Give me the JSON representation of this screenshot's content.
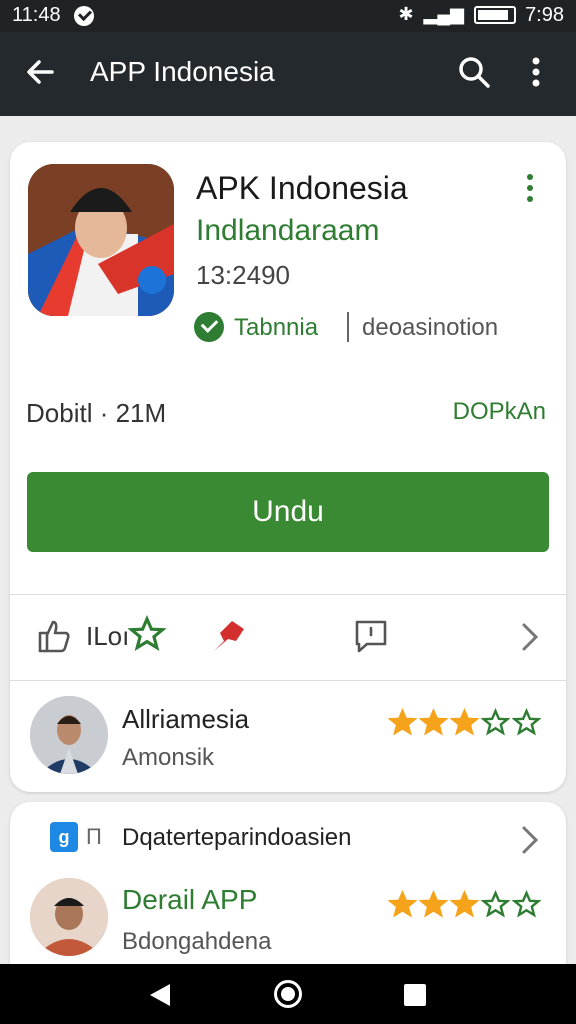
{
  "status_bar": {
    "time": "11:48",
    "clock": "7:98",
    "icons": [
      "check-circle-icon",
      "bluetooth-icon",
      "signal-icon",
      "battery-icon"
    ]
  },
  "app_bar": {
    "title": "APP Indonesia",
    "icons": [
      "back-arrow-icon",
      "search-icon",
      "more-vert-icon"
    ]
  },
  "app": {
    "name": "APK Indonesia",
    "developer": "Indlandaraam",
    "code": "13:2490",
    "verified_label": "Tabnnia",
    "verified_desc": "deoasinotion",
    "downloads": "Dobitl · 21M",
    "side_link": "DOPkAn",
    "install_label": "Undu"
  },
  "actions": {
    "label": "ILoı",
    "icons": [
      "share-icon",
      "star-outline-icon",
      "pin-icon",
      "chat-icon",
      "chevron-right-icon"
    ]
  },
  "review": {
    "name": "Allriamesia",
    "sub": "Amonsik",
    "rating": 3,
    "max_rating": 5
  },
  "card2": {
    "icon_glyph": "g",
    "icon_sub": "Π",
    "title": "Dqaterteparindoasien",
    "name": "Derail APP",
    "sub": "Bdongahdena",
    "rating": 3,
    "max_rating": 5
  },
  "colors": {
    "accent_green": "#398a32",
    "text_green": "#2e7d32",
    "star": "#f4a31b",
    "appbar": "#24292d",
    "pin_red": "#d32f2f"
  }
}
